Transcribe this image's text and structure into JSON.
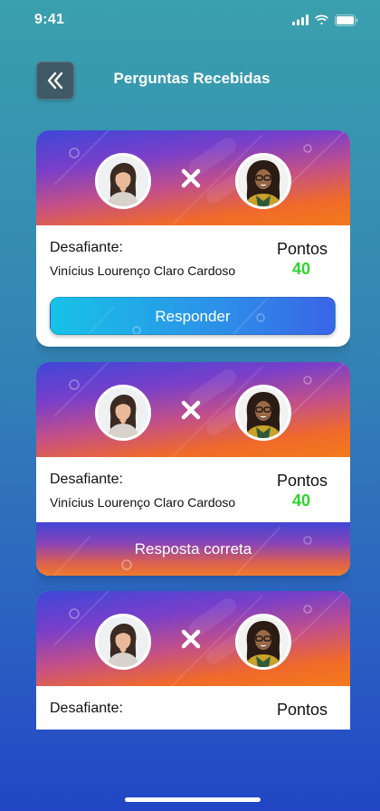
{
  "status_bar": {
    "time": "9:41"
  },
  "header": {
    "title": "Perguntas Recebidas"
  },
  "cards": [
    {
      "challenger_label": "Desafiante:",
      "challenger_name": "Vinícius Lourenço Claro Cardoso",
      "points_label": "Pontos",
      "points_value": "40",
      "action_label": "Responder",
      "state": "pending"
    },
    {
      "challenger_label": "Desafiante:",
      "challenger_name": "Vinícius Lourenço Claro Cardoso",
      "points_label": "Pontos",
      "points_value": "40",
      "result_label": "Resposta correta",
      "state": "answered"
    },
    {
      "challenger_label": "Desafiante:",
      "points_label": "Pontos",
      "state": "partial"
    }
  ],
  "colors": {
    "points": "#2ed32e",
    "respond_button": "#1fa9e8",
    "banner_start": "#3e47d8",
    "banner_end": "#f37a1c"
  }
}
